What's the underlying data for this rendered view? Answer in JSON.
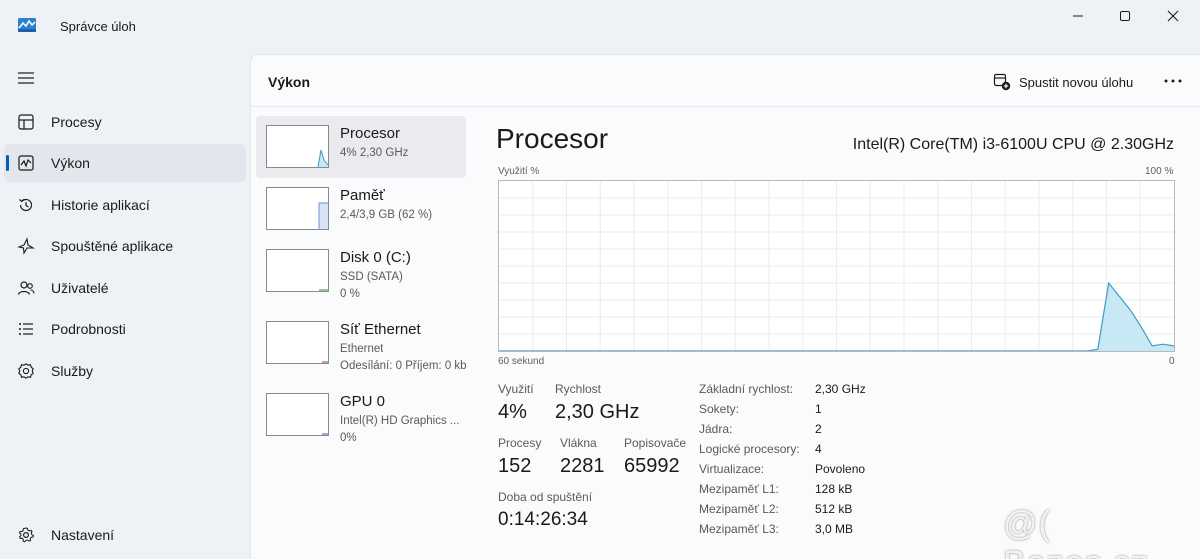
{
  "window": {
    "title": "Správce úloh"
  },
  "sidebar": {
    "items": [
      {
        "label": "Procesy",
        "icon": "grid-icon"
      },
      {
        "label": "Výkon",
        "icon": "performance-icon",
        "active": true
      },
      {
        "label": "Historie aplikací",
        "icon": "history-icon"
      },
      {
        "label": "Spouštěné aplikace",
        "icon": "startup-icon"
      },
      {
        "label": "Uživatelé",
        "icon": "users-icon"
      },
      {
        "label": "Podrobnosti",
        "icon": "details-icon"
      },
      {
        "label": "Služby",
        "icon": "services-icon"
      }
    ],
    "settings_label": "Nastavení"
  },
  "header": {
    "page_title": "Výkon",
    "new_task_label": "Spustit novou úlohu"
  },
  "devices": [
    {
      "name": "Procesor",
      "line1": "4% 2,30 GHz",
      "line2": ""
    },
    {
      "name": "Paměť",
      "line1": "2,4/3,9 GB (62 %)",
      "line2": ""
    },
    {
      "name": "Disk 0 (C:)",
      "line1": "SSD (SATA)",
      "line2": "0 %"
    },
    {
      "name": "Síť Ethernet",
      "line1": "Ethernet",
      "line2": "Odesílání: 0 Příjem: 0 kb"
    },
    {
      "name": "GPU 0",
      "line1": "Intel(R) HD Graphics ...",
      "line2": "0%"
    }
  ],
  "cpu": {
    "title": "Procesor",
    "model": "Intel(R) Core(TM) i3-6100U CPU @ 2.30GHz",
    "graph": {
      "y_label": "Využití %",
      "y_max_label": "100 %",
      "x_left_label": "60 sekund",
      "x_right_label": "0",
      "series_values": [
        0,
        0,
        0,
        0,
        0,
        0,
        0,
        0,
        0,
        0,
        0,
        0,
        0,
        0,
        0,
        0,
        0,
        0,
        0,
        0,
        0,
        0,
        0,
        0,
        0,
        0,
        0,
        0,
        0,
        0,
        0,
        0,
        0,
        0,
        0,
        0,
        0,
        0,
        0,
        0,
        0,
        0,
        0,
        0,
        0,
        0,
        0,
        0,
        0,
        0,
        0,
        0,
        0,
        0,
        0,
        1,
        40,
        32,
        24,
        14,
        3,
        4,
        3
      ]
    },
    "stats": {
      "utilization_label": "Využití",
      "utilization_value": "4%",
      "speed_label": "Rychlost",
      "speed_value": "2,30 GHz",
      "processes_label": "Procesy",
      "processes_value": "152",
      "threads_label": "Vlákna",
      "threads_value": "2281",
      "handles_label": "Popisovače",
      "handles_value": "65992",
      "uptime_label": "Doba od spuštění",
      "uptime_value": "0:14:26:34"
    },
    "details": [
      {
        "label": "Základní rychlost:",
        "value": "2,30 GHz"
      },
      {
        "label": "Sokety:",
        "value": "1"
      },
      {
        "label": "Jádra:",
        "value": "2"
      },
      {
        "label": "Logické procesory:",
        "value": "4"
      },
      {
        "label": "Virtualizace:",
        "value": "Povoleno"
      },
      {
        "label": "Mezipaměť L1:",
        "value": "128 kB"
      },
      {
        "label": "Mezipaměť L2:",
        "value": "512 kB"
      },
      {
        "label": "Mezipaměť L3:",
        "value": "3,0 MB"
      }
    ]
  },
  "colors": {
    "accent": "#005fb8",
    "cpu_line": "#3b9dc7",
    "cpu_fill": "#c9e8f6",
    "memory_line": "#6b95d6",
    "disk_line": "#4f9c4f",
    "network_line": "#b05090",
    "gpu_line": "#8e56c9"
  },
  "watermark": "@( Bazos.cz"
}
